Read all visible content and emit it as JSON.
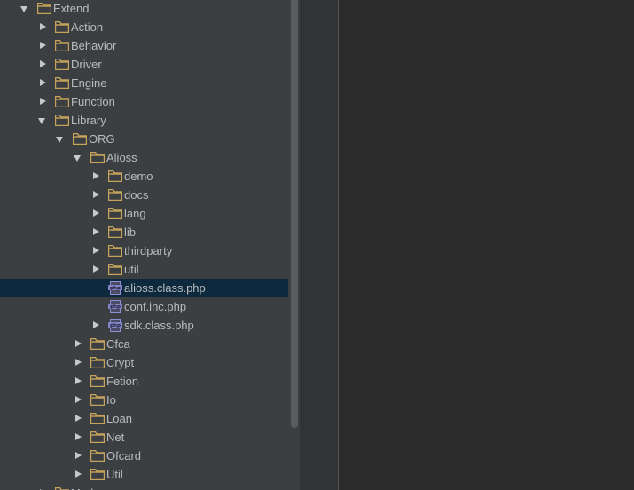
{
  "tree": [
    {
      "label": "Extend",
      "depth": 0,
      "kind": "folder",
      "state": "expanded"
    },
    {
      "label": "Action",
      "depth": 1,
      "kind": "folder",
      "state": "collapsed"
    },
    {
      "label": "Behavior",
      "depth": 1,
      "kind": "folder",
      "state": "collapsed"
    },
    {
      "label": "Driver",
      "depth": 1,
      "kind": "folder",
      "state": "collapsed"
    },
    {
      "label": "Engine",
      "depth": 1,
      "kind": "folder",
      "state": "collapsed"
    },
    {
      "label": "Function",
      "depth": 1,
      "kind": "folder",
      "state": "collapsed"
    },
    {
      "label": "Library",
      "depth": 1,
      "kind": "folder",
      "state": "expanded"
    },
    {
      "label": "ORG",
      "depth": 2,
      "kind": "folder",
      "state": "expanded"
    },
    {
      "label": "Alioss",
      "depth": 3,
      "kind": "folder",
      "state": "expanded"
    },
    {
      "label": "demo",
      "depth": 4,
      "kind": "folder",
      "state": "collapsed"
    },
    {
      "label": "docs",
      "depth": 4,
      "kind": "folder",
      "state": "collapsed"
    },
    {
      "label": "lang",
      "depth": 4,
      "kind": "folder",
      "state": "collapsed"
    },
    {
      "label": "lib",
      "depth": 4,
      "kind": "folder",
      "state": "collapsed"
    },
    {
      "label": "thirdparty",
      "depth": 4,
      "kind": "folder",
      "state": "collapsed"
    },
    {
      "label": "util",
      "depth": 4,
      "kind": "folder",
      "state": "collapsed"
    },
    {
      "label": "alioss.class.php",
      "depth": 4,
      "kind": "php",
      "state": "none",
      "selected": true
    },
    {
      "label": "conf.inc.php",
      "depth": 4,
      "kind": "php",
      "state": "none"
    },
    {
      "label": "sdk.class.php",
      "depth": 4,
      "kind": "php",
      "state": "collapsed"
    },
    {
      "label": "Cfca",
      "depth": 3,
      "kind": "folder",
      "state": "collapsed"
    },
    {
      "label": "Crypt",
      "depth": 3,
      "kind": "folder",
      "state": "collapsed"
    },
    {
      "label": "Fetion",
      "depth": 3,
      "kind": "folder",
      "state": "collapsed"
    },
    {
      "label": "Io",
      "depth": 3,
      "kind": "folder",
      "state": "collapsed"
    },
    {
      "label": "Loan",
      "depth": 3,
      "kind": "folder",
      "state": "collapsed"
    },
    {
      "label": "Net",
      "depth": 3,
      "kind": "folder",
      "state": "collapsed"
    },
    {
      "label": "Ofcard",
      "depth": 3,
      "kind": "folder",
      "state": "collapsed"
    },
    {
      "label": "Util",
      "depth": 3,
      "kind": "folder",
      "state": "collapsed"
    },
    {
      "label": "Mode",
      "depth": 1,
      "kind": "folder",
      "state": "collapsed"
    }
  ],
  "colors": {
    "panel_bg": "#3c3f41",
    "editor_bg": "#2b2b2b",
    "text": "#bbbbbb",
    "selection": "#0d293e",
    "folder": "#c7a45c",
    "php_icon": "#8c8fd4"
  }
}
